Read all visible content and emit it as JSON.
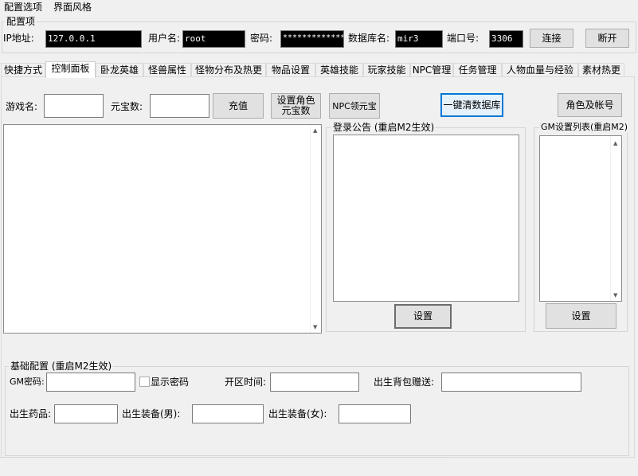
{
  "menu": {
    "config_options": "配置选项",
    "ui_style": "界面风格"
  },
  "conn": {
    "group_title": "配置项",
    "ip_label": "IP地址:",
    "ip_value": "127.0.0.1",
    "user_label": "用户名:",
    "user_value": "root",
    "pwd_label": "密码:",
    "pwd_value": "*************",
    "db_label": "数据库名:",
    "db_value": "mir3",
    "port_label": "端口号:",
    "port_value": "3306",
    "connect": "连接",
    "disconnect": "断开"
  },
  "tabs": [
    "快捷方式",
    "控制面板",
    "卧龙英雄",
    "怪兽属性",
    "怪物分布及热更",
    "物品设置",
    "英雄技能",
    "玩家技能",
    "NPC管理",
    "任务管理",
    "人物血量与经验",
    "素材热更"
  ],
  "panel": {
    "game_name_label": "游戏名:",
    "game_name_value": "",
    "yuanbao_label": "元宝数:",
    "yuanbao_value": "",
    "recharge": "充值",
    "set_role_yuanbao": "设置角色元宝数",
    "npc_yuanbao": "NPC领元宝",
    "clear_db": "一键清数据库",
    "role_account": "角色及帐号",
    "login_notice_title": "登录公告 (重启M2生效)",
    "gm_list_title": "GM设置列表(重启M2)",
    "set1": "设置",
    "set2": "设置"
  },
  "basic": {
    "title": "基础配置 (重启M2生效)",
    "gm_pwd_label": "GM密码:",
    "show_pwd": "显示密码",
    "open_time_label": "开区时间:",
    "bag_gift_label": "出生背包赠送:",
    "potion_label": "出生药品:",
    "equip_male_label": "出生装备(男):",
    "equip_female_label": "出生装备(女):"
  }
}
